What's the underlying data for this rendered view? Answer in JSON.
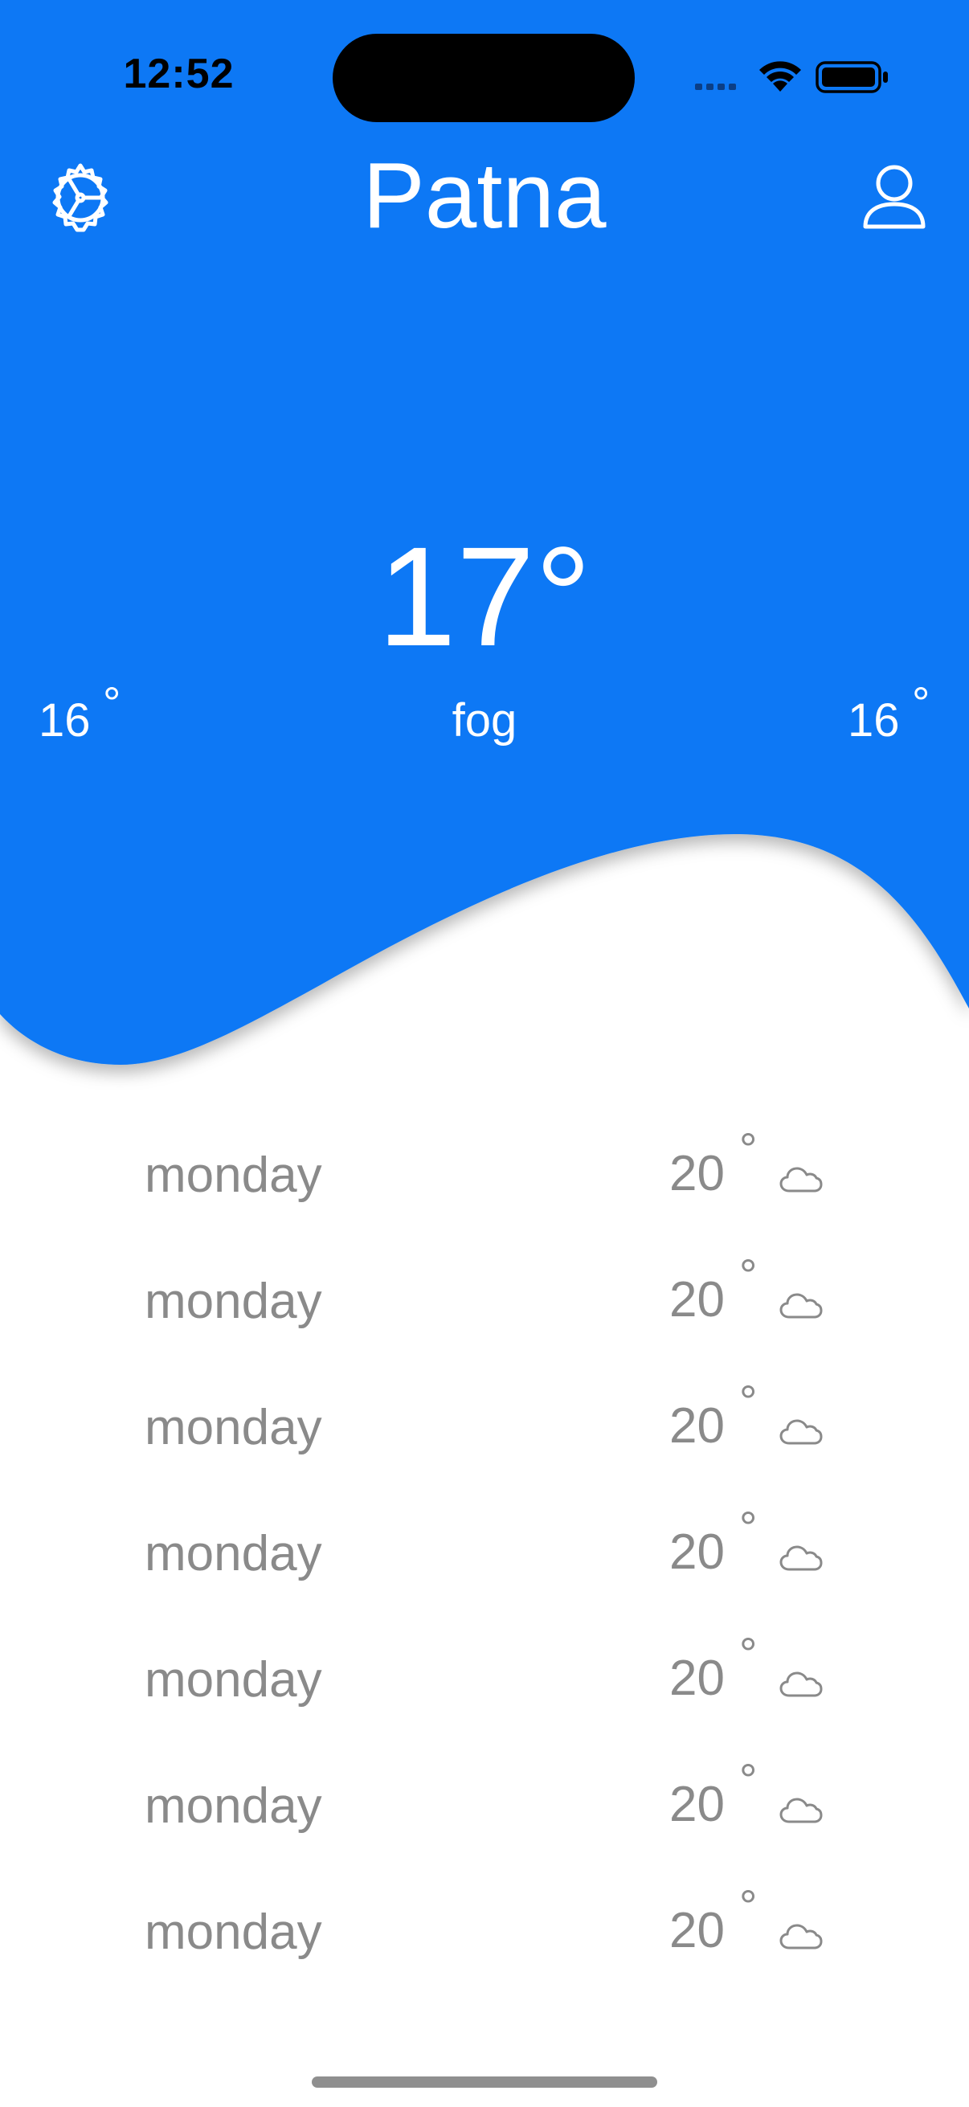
{
  "status_bar": {
    "time": "12:52"
  },
  "header": {
    "city": "Patna",
    "settings_icon": "gear-icon",
    "profile_icon": "person-icon"
  },
  "current": {
    "temperature": "17°",
    "condition": "fog",
    "min_temp": "16",
    "max_temp": "16",
    "degree_symbol": "°"
  },
  "forecast": [
    {
      "day": "monday",
      "temp": "20",
      "degree_symbol": "°",
      "icon": "cloud-icon"
    },
    {
      "day": "monday",
      "temp": "20",
      "degree_symbol": "°",
      "icon": "cloud-icon"
    },
    {
      "day": "monday",
      "temp": "20",
      "degree_symbol": "°",
      "icon": "cloud-icon"
    },
    {
      "day": "monday",
      "temp": "20",
      "degree_symbol": "°",
      "icon": "cloud-icon"
    },
    {
      "day": "monday",
      "temp": "20",
      "degree_symbol": "°",
      "icon": "cloud-icon"
    },
    {
      "day": "monday",
      "temp": "20",
      "degree_symbol": "°",
      "icon": "cloud-icon"
    },
    {
      "day": "monday",
      "temp": "20",
      "degree_symbol": "°",
      "icon": "cloud-icon"
    }
  ],
  "colors": {
    "accent": "#0A78F5",
    "text_on_accent": "#FFFFFF",
    "list_text": "#8A8A8A"
  }
}
